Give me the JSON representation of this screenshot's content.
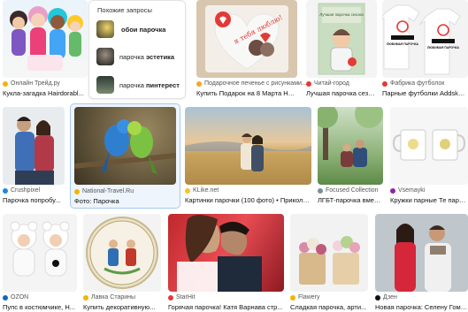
{
  "similar": {
    "header": "Похожие запросы",
    "items": [
      {
        "base": "обои парочка",
        "bold": ""
      },
      {
        "base": "парочка",
        "bold": "эстетика"
      },
      {
        "base": "парочка",
        "bold": "пинтерест"
      }
    ]
  },
  "cards": [
    {
      "source": "Онлайн Трейд.ру",
      "title": "Кукла-загадка Hairdorabl...",
      "source_color": "#f4b400"
    },
    {
      "source": "Подарочное печенье с рисунками...",
      "title": "Купить Подарок на 8 Марта Нев...",
      "source_color": "#f7a823"
    },
    {
      "source": "Читай-город",
      "title": "Лучшая парочка сезо...",
      "source_color": "#e53935"
    },
    {
      "source": "Фабрика футболок",
      "title": "Парные футболки Addskar...",
      "source_color": "#e53935"
    },
    {
      "source": "Crushpixel",
      "title": "Парочка попробу...",
      "source_color": "#1e88e5"
    },
    {
      "source": "National-Travel.Ru",
      "title": "Фото: Парочка",
      "source_color": "#f4b400"
    },
    {
      "source": "KLike.net",
      "title": "Картинки парочки (100 фото) • Приколь...",
      "source_color": "#fbc02d"
    },
    {
      "source": "Focused Collection",
      "title": "ЛГБТ-парочка вместе...",
      "source_color": "#78909c"
    },
    {
      "source": "Vsemayki",
      "title": "Кружки парные Те парочк...",
      "source_color": "#8e24aa"
    },
    {
      "source": "OZON",
      "title": "Пупс в костюмчике, Н...",
      "source_color": "#1565c0"
    },
    {
      "source": "Лавка Старины",
      "title": "Купить декоративную...",
      "source_color": "#f4b400"
    },
    {
      "source": "StarHit",
      "title": "Горячая парочка! Катя Варнава стр...",
      "source_color": "#e53935"
    },
    {
      "source": "Flawery",
      "title": "Сладкая парочка, арти...",
      "source_color": "#f4b400"
    },
    {
      "source": "Дзен",
      "title": "Новая парочка: Селену Гомес...",
      "source_color": "#111111"
    }
  ],
  "images": {
    "gift_box_text": "я тебя люблю!",
    "book_title": "Лучшая парочка сезона",
    "tshirt_text_1": "ЛЮБИМАЯ ПАРОЧКА",
    "tshirt_text_2": "ЛЮБИМАЯ ПАРОЧКА"
  }
}
